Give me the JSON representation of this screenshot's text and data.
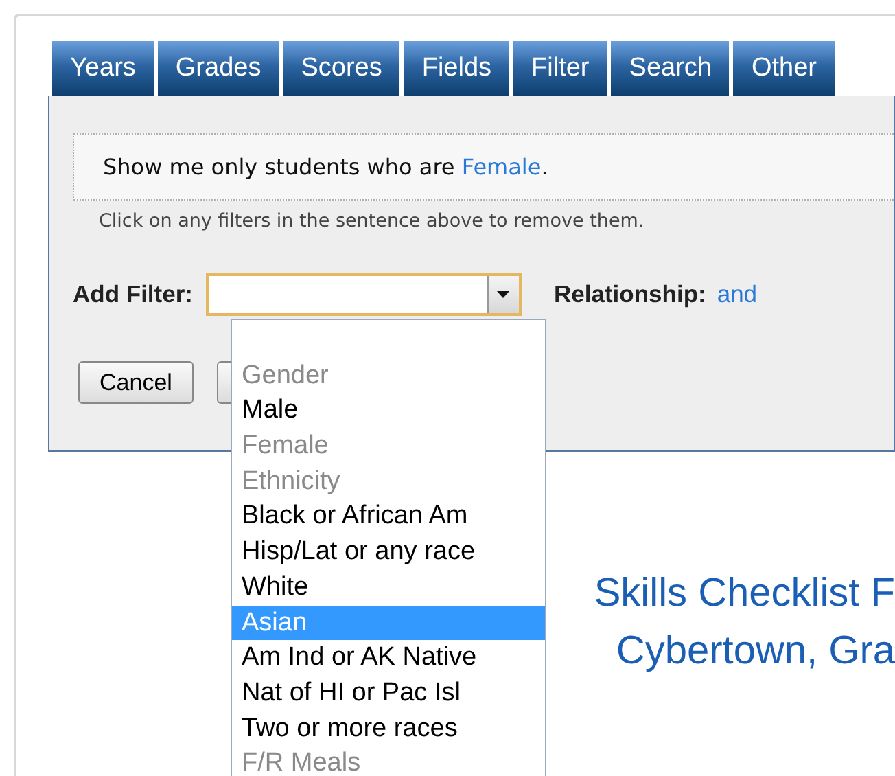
{
  "tabs": [
    {
      "label": "Years"
    },
    {
      "label": "Grades"
    },
    {
      "label": "Scores"
    },
    {
      "label": "Fields"
    },
    {
      "label": "Filter"
    },
    {
      "label": "Search"
    },
    {
      "label": "Other"
    }
  ],
  "sentence": {
    "text": "Show me only students who are ",
    "link": "Female",
    "end": "."
  },
  "hint": "Click on any filters in the sentence above to remove them.",
  "add_filter": {
    "label": "Add Filter:"
  },
  "relationship": {
    "label": "Relationship:",
    "value": "and"
  },
  "buttons": [
    "Cancel"
  ],
  "dropdown": [
    {
      "kind": "blank"
    },
    {
      "kind": "group",
      "label": "Gender"
    },
    {
      "kind": "option",
      "label": "Male",
      "selected": false,
      "disabled": false
    },
    {
      "kind": "option",
      "label": "Female",
      "selected": false,
      "disabled": true
    },
    {
      "kind": "group",
      "label": "Ethnicity"
    },
    {
      "kind": "option",
      "label": "Black or African Am",
      "selected": false,
      "disabled": false
    },
    {
      "kind": "option",
      "label": "Hisp/Lat or any race",
      "selected": false,
      "disabled": false
    },
    {
      "kind": "option",
      "label": "White",
      "selected": false,
      "disabled": false
    },
    {
      "kind": "option",
      "label": "Asian",
      "selected": true,
      "disabled": false
    },
    {
      "kind": "option",
      "label": "Am Ind or AK Native",
      "selected": false,
      "disabled": false
    },
    {
      "kind": "option",
      "label": "Nat of HI or Pac Isl",
      "selected": false,
      "disabled": false
    },
    {
      "kind": "option",
      "label": "Two or more races",
      "selected": false,
      "disabled": false
    },
    {
      "kind": "group",
      "label": "F/R Meals"
    }
  ],
  "report_title": [
    "Skills Checklist F",
    "Cybertown, Gra"
  ]
}
